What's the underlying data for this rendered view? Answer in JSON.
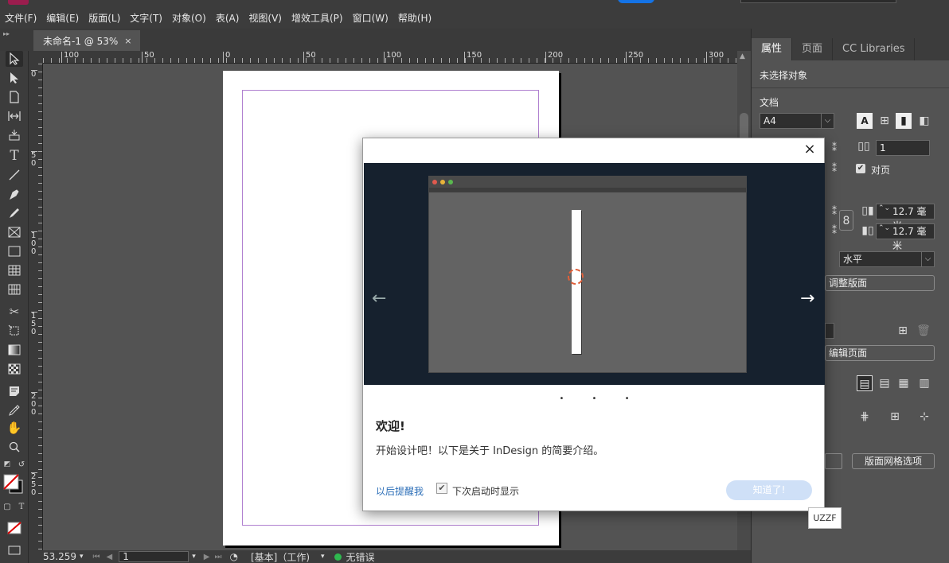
{
  "menu": [
    "文件(F)",
    "编辑(E)",
    "版面(L)",
    "文字(T)",
    "对象(O)",
    "表(A)",
    "视图(V)",
    "增效工具(P)",
    "窗口(W)",
    "帮助(H)"
  ],
  "document_tab": {
    "title": "未命名-1 @ 53%",
    "close": "×"
  },
  "ruler_h": [
    "100",
    "50",
    "0",
    "50",
    "100",
    "150",
    "200",
    "250",
    "300"
  ],
  "ruler_v": [
    "0",
    "50",
    "100",
    "150",
    "200",
    "250"
  ],
  "status": {
    "zoom": "53.259",
    "page": "1",
    "layout": "[基本]（工作)",
    "errors": "无错误"
  },
  "panel": {
    "tabs": [
      "属性",
      "页面",
      "CC Libraries"
    ],
    "no_selection": "未选择对象",
    "document_label": "文档",
    "page_size": "A4",
    "pages_count": "1",
    "facing_pages": "对页",
    "margin_value_1": "12.7 毫米",
    "margin_value_2": "12.7 毫米",
    "orientation": "水平",
    "adjust_layout": "调整版面",
    "edit_page": "编辑页面",
    "grid_options": "版面网格选项"
  },
  "dialog": {
    "title": "欢迎!",
    "body": "开始设计吧！以下是关于 InDesign 的简要介绍。",
    "remind_later": "以后提醒我",
    "show_on_startup": "下次启动时显示",
    "got_it": "知道了!",
    "close": "×",
    "prev_arrow": "←",
    "next_arrow": "→",
    "dots": "• • •"
  },
  "tooltip": "UZZF",
  "colors": {
    "accent": "#1473e6",
    "canvas": "#535353",
    "panel": "#3c3c3c",
    "dialog_slide": "#16212e"
  }
}
